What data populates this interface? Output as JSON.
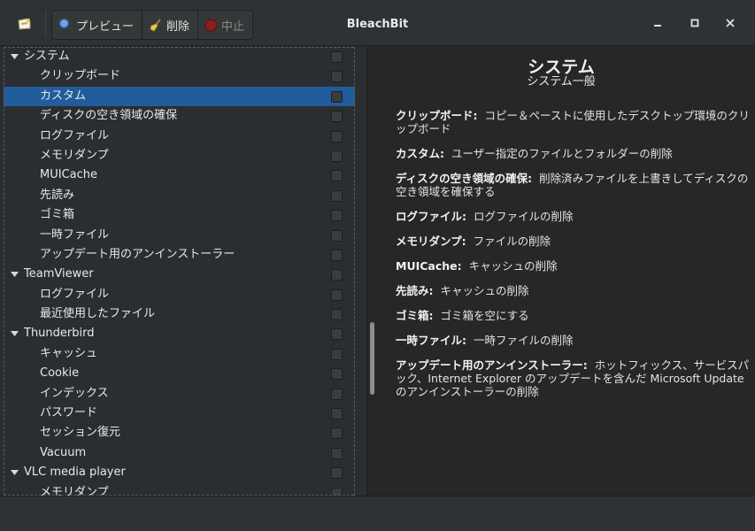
{
  "window": {
    "title": "BleachBit"
  },
  "toolbar": {
    "preview_label": "プレビュー",
    "clean_label": "削除",
    "stop_label": "中止"
  },
  "tree": [
    {
      "type": "group",
      "label": "システム"
    },
    {
      "type": "item",
      "label": "クリップボード"
    },
    {
      "type": "item",
      "label": "カスタム",
      "selected": true
    },
    {
      "type": "item",
      "label": "ディスクの空き領域の確保"
    },
    {
      "type": "item",
      "label": "ログファイル"
    },
    {
      "type": "item",
      "label": "メモリダンプ"
    },
    {
      "type": "item",
      "label": "MUICache"
    },
    {
      "type": "item",
      "label": "先読み"
    },
    {
      "type": "item",
      "label": "ゴミ箱"
    },
    {
      "type": "item",
      "label": "一時ファイル"
    },
    {
      "type": "item",
      "label": "アップデート用のアンインストーラー"
    },
    {
      "type": "group",
      "label": "TeamViewer"
    },
    {
      "type": "item",
      "label": "ログファイル"
    },
    {
      "type": "item",
      "label": "最近使用したファイル"
    },
    {
      "type": "group",
      "label": "Thunderbird"
    },
    {
      "type": "item",
      "label": "キャッシュ"
    },
    {
      "type": "item",
      "label": "Cookie"
    },
    {
      "type": "item",
      "label": "インデックス"
    },
    {
      "type": "item",
      "label": "パスワード"
    },
    {
      "type": "item",
      "label": "セッション復元"
    },
    {
      "type": "item",
      "label": "Vacuum"
    },
    {
      "type": "group",
      "label": "VLC media player"
    },
    {
      "type": "item",
      "label": "メモリダンプ"
    }
  ],
  "description": {
    "title": "システム",
    "subtitle": "システム一般",
    "entries": [
      {
        "key": "クリップボード:",
        "text": "コピー＆ペーストに使用したデスクトップ環境のクリップボード"
      },
      {
        "key": "カスタム:",
        "text": "ユーザー指定のファイルとフォルダーの削除"
      },
      {
        "key": "ディスクの空き領域の確保:",
        "text": "削除済みファイルを上書きしてディスクの空き領域を確保する"
      },
      {
        "key": "ログファイル:",
        "text": "ログファイルの削除"
      },
      {
        "key": "メモリダンプ:",
        "text": "ファイルの削除"
      },
      {
        "key": "MUICache:",
        "text": "キャッシュの削除"
      },
      {
        "key": "先読み:",
        "text": "キャッシュの削除"
      },
      {
        "key": "ゴミ箱:",
        "text": "ゴミ箱を空にする"
      },
      {
        "key": "一時ファイル:",
        "text": "一時ファイルの削除"
      },
      {
        "key": "アップデート用のアンインストーラー:",
        "text": "ホットフィックス、サービスパック、Internet Explorer のアップデートを含んだ Microsoft Update のアンインストーラーの削除"
      }
    ]
  },
  "colors": {
    "selection": "#215d9c",
    "background": "#2b2e30",
    "description_bg": "#252729"
  }
}
